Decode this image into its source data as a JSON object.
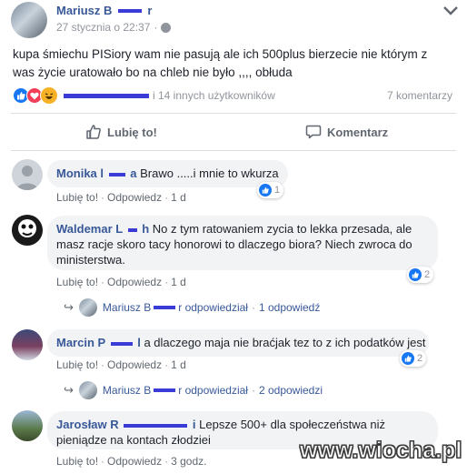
{
  "post": {
    "author_first": "Mariusz B",
    "author_last_end": "r",
    "time": "27 stycznia o 22:37",
    "text_line1": "kupa śmiechu PISiory wam nie pasują ale ich 500plus bierzecie nie którym z",
    "text_line2": "was życie uratowało bo na chleb nie było ,,,, obłuda",
    "reactions_others": "i 14 innych użytkowników",
    "comments_count": "7 komentarzy",
    "like_label": "Lubię to!",
    "comment_label": "Komentarz"
  },
  "comments": [
    {
      "name_a": "Monika l",
      "name_b": "a",
      "text_l1": "Brawo .....i mnie to wkurza",
      "text_l2": "",
      "text_l3": "",
      "like": "Lubię to!",
      "reply": "Odpowiedz",
      "age": "1 d",
      "reactions": "1"
    },
    {
      "name_a": "Waldemar L",
      "name_b": "h",
      "text_l1": "No z tym ratowaniem zycia to lekka przesada, ale",
      "text_l2": "masz racje skoro tacy honorowi to dlaczego biora? Niech zwroca do",
      "text_l3": "ministerstwa.",
      "like": "Lubię to!",
      "reply": "Odpowiedz",
      "age": "1 d",
      "reactions": "2",
      "thread": {
        "name_a": "Mariusz B",
        "name_b": "r odpowiedział",
        "count": "1 odpowiedź"
      }
    },
    {
      "name_a": "Marcin P",
      "name_b": "l",
      "text_l1": "a dlaczego maja nie braćjak tez to z ich podatków jest",
      "text_l2": "",
      "text_l3": "",
      "like": "Lubię to!",
      "reply": "Odpowiedz",
      "age": "1 d",
      "reactions": "2",
      "thread": {
        "name_a": "Mariusz B",
        "name_b": "r odpowiedział",
        "count": "2 odpowiedzi"
      }
    },
    {
      "name_a": "Jarosław R",
      "name_b": "i",
      "text_l1": "Lepsze 500+ dla społeczeństwa niż",
      "text_l2": "pieniądze na kontach złodziei",
      "text_l3": "",
      "like": "Lubię to!",
      "reply": "Odpowiedz",
      "age": "3 godz."
    }
  ],
  "watermark": "www.wiocha.pl",
  "colors": {
    "link": "#385898",
    "like_blue": "#1877f2",
    "love_red": "#f33e58",
    "haha_yellow": "#f7b125",
    "bubble": "#f2f3f5",
    "redaction": "#3b3bd6"
  },
  "icons": [
    "avatar",
    "chevron-down-icon",
    "like-reaction-icon",
    "love-reaction-icon",
    "haha-reaction-icon",
    "thumbs-up-icon",
    "comment-icon",
    "reply-arrow-icon"
  ]
}
